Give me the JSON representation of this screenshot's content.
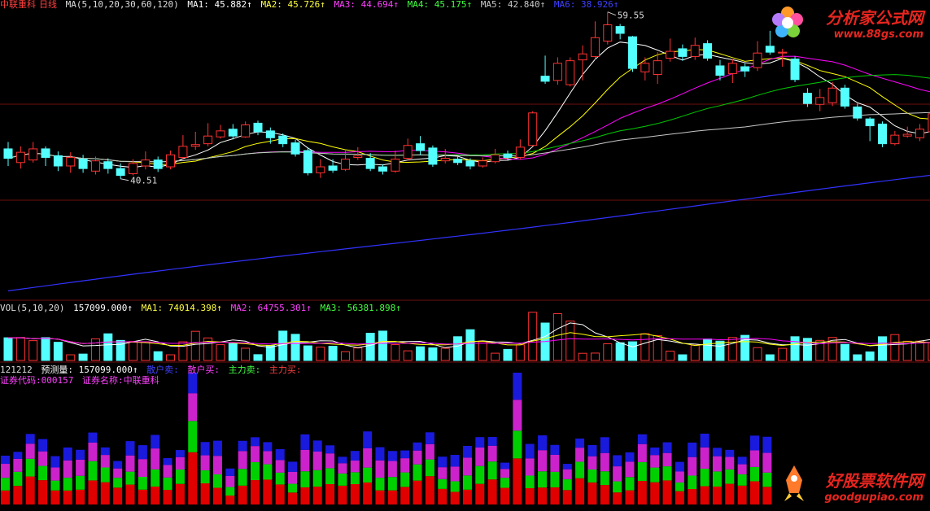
{
  "header_main": {
    "title": "中联重科",
    "period": "日线",
    "ma_label": "MA(5,10,20,30,60,120)",
    "ma1": "MA1: 45.882↑",
    "ma2": "MA2: 45.726↑",
    "ma3": "MA3: 44.694↑",
    "ma4": "MA4: 45.175↑",
    "ma5": "MA5: 42.840↑",
    "ma6": "MA6: 38.926↑"
  },
  "header_vol": {
    "label": "VOL(5,10,20)",
    "vol": "157099.000↑",
    "ma1": "MA1: 74014.398↑",
    "ma2": "MA2: 64755.301↑",
    "ma3": "MA3: 56381.898↑"
  },
  "header_ind": {
    "date": "121212",
    "forecast": "预测量: 157099.000↑",
    "retail_sell": "散户卖:",
    "retail_buy": "散户买:",
    "main_sell": "主力卖:",
    "main_buy": "主力买:"
  },
  "header_sec": {
    "code": "证券代码:000157",
    "name": "证券名称:中联重科"
  },
  "colors": {
    "up": "#ff3232",
    "down": "#54ffff",
    "ma5": "#ffffff",
    "ma10": "#ffff00",
    "ma20": "#ff00ff",
    "ma30": "#00cc00",
    "ma60": "#c8c8c8",
    "ma120": "#3232ff",
    "ind_red": "#e00000",
    "ind_green": "#00d000",
    "ind_magenta": "#cc22cc",
    "ind_blue": "#1a1add"
  },
  "watermarks": {
    "top_title": "分析家公式网",
    "top_url": "www.88gs.com",
    "bottom_title": "好股票软件网",
    "bottom_url": "goodgupiao.com"
  },
  "chart_data": {
    "type": "candlestick",
    "price_range": [
      26,
      61
    ],
    "annotations": {
      "high": "59.55",
      "low": "40.51"
    },
    "candles": [
      {
        "o": 43.6,
        "c": 42.5,
        "h": 44.4,
        "l": 41.6
      },
      {
        "o": 42.0,
        "c": 43.2,
        "h": 43.9,
        "l": 41.3
      },
      {
        "o": 42.3,
        "c": 43.6,
        "h": 44.4,
        "l": 42.0
      },
      {
        "o": 43.6,
        "c": 42.6,
        "h": 43.9,
        "l": 41.6
      },
      {
        "o": 42.8,
        "c": 41.6,
        "h": 43.3,
        "l": 41.0
      },
      {
        "o": 41.6,
        "c": 42.6,
        "h": 43.2,
        "l": 40.8
      },
      {
        "o": 42.4,
        "c": 41.3,
        "h": 42.9,
        "l": 40.8
      },
      {
        "o": 41.0,
        "c": 42.2,
        "h": 42.7,
        "l": 40.6
      },
      {
        "o": 42.1,
        "c": 41.3,
        "h": 42.5,
        "l": 40.7
      },
      {
        "o": 41.3,
        "c": 40.5,
        "h": 41.9,
        "l": 40.1
      },
      {
        "o": 40.7,
        "c": 41.9,
        "h": 42.4,
        "l": 40.5
      },
      {
        "o": 41.6,
        "c": 42.3,
        "h": 43.3,
        "l": 41.2
      },
      {
        "o": 42.3,
        "c": 41.3,
        "h": 42.7,
        "l": 40.9
      },
      {
        "o": 41.5,
        "c": 42.9,
        "h": 43.4,
        "l": 41.2
      },
      {
        "o": 42.6,
        "c": 43.9,
        "h": 45.2,
        "l": 42.4
      },
      {
        "o": 43.9,
        "c": 44.1,
        "h": 45.6,
        "l": 43.5
      },
      {
        "o": 44.2,
        "c": 45.1,
        "h": 46.6,
        "l": 43.9
      },
      {
        "o": 45.0,
        "c": 45.7,
        "h": 46.4,
        "l": 44.8
      },
      {
        "o": 45.9,
        "c": 45.1,
        "h": 46.5,
        "l": 44.7
      },
      {
        "o": 45.0,
        "c": 46.4,
        "h": 46.8,
        "l": 44.9
      },
      {
        "o": 46.6,
        "c": 45.6,
        "h": 46.9,
        "l": 45.2
      },
      {
        "o": 45.7,
        "c": 44.9,
        "h": 46.1,
        "l": 44.2
      },
      {
        "o": 45.1,
        "c": 44.2,
        "h": 45.4,
        "l": 43.8
      },
      {
        "o": 44.3,
        "c": 43.0,
        "h": 44.7,
        "l": 42.7
      },
      {
        "o": 43.4,
        "c": 40.8,
        "h": 43.8,
        "l": 40.5
      },
      {
        "o": 40.8,
        "c": 41.5,
        "h": 42.4,
        "l": 40.2
      },
      {
        "o": 41.6,
        "c": 41.1,
        "h": 42.4,
        "l": 40.8
      },
      {
        "o": 41.2,
        "c": 42.4,
        "h": 43.4,
        "l": 41.0
      },
      {
        "o": 42.6,
        "c": 42.8,
        "h": 43.8,
        "l": 42.3
      },
      {
        "o": 42.5,
        "c": 41.3,
        "h": 43.1,
        "l": 41.0
      },
      {
        "o": 41.5,
        "c": 41.0,
        "h": 41.8,
        "l": 40.6
      },
      {
        "o": 41.0,
        "c": 42.4,
        "h": 43.4,
        "l": 40.8
      },
      {
        "o": 42.5,
        "c": 44.0,
        "h": 44.8,
        "l": 42.2
      },
      {
        "o": 44.2,
        "c": 43.4,
        "h": 45.1,
        "l": 42.9
      },
      {
        "o": 43.7,
        "c": 41.8,
        "h": 44.0,
        "l": 41.5
      },
      {
        "o": 42.2,
        "c": 42.5,
        "h": 43.6,
        "l": 41.9
      },
      {
        "o": 42.4,
        "c": 42.0,
        "h": 42.8,
        "l": 41.7
      },
      {
        "o": 42.2,
        "c": 41.6,
        "h": 42.5,
        "l": 41.2
      },
      {
        "o": 41.6,
        "c": 42.2,
        "h": 42.6,
        "l": 41.4
      },
      {
        "o": 42.1,
        "c": 42.9,
        "h": 43.6,
        "l": 41.9
      },
      {
        "o": 43.0,
        "c": 42.6,
        "h": 43.4,
        "l": 42.3
      },
      {
        "o": 42.6,
        "c": 43.8,
        "h": 44.7,
        "l": 42.4
      },
      {
        "o": 44.0,
        "c": 47.8,
        "h": 48.0,
        "l": 44.0
      },
      {
        "o": 52.1,
        "c": 51.5,
        "h": 54.5,
        "l": 51.2
      },
      {
        "o": 51.6,
        "c": 53.6,
        "h": 54.3,
        "l": 51.1
      },
      {
        "o": 51.1,
        "c": 53.9,
        "h": 54.3,
        "l": 50.9
      },
      {
        "o": 54.0,
        "c": 54.7,
        "h": 55.7,
        "l": 51.6
      },
      {
        "o": 54.4,
        "c": 56.6,
        "h": 58.5,
        "l": 54.0
      },
      {
        "o": 56.2,
        "c": 58.1,
        "h": 59.6,
        "l": 55.8
      },
      {
        "o": 57.9,
        "c": 57.1,
        "h": 58.2,
        "l": 56.4
      },
      {
        "o": 56.7,
        "c": 53.0,
        "h": 56.8,
        "l": 52.6
      },
      {
        "o": 52.6,
        "c": 53.6,
        "h": 54.3,
        "l": 51.6
      },
      {
        "o": 52.3,
        "c": 53.9,
        "h": 54.9,
        "l": 51.2
      },
      {
        "o": 54.2,
        "c": 55.0,
        "h": 56.5,
        "l": 53.8
      },
      {
        "o": 55.3,
        "c": 54.4,
        "h": 55.8,
        "l": 53.9
      },
      {
        "o": 54.4,
        "c": 55.7,
        "h": 56.6,
        "l": 54.0
      },
      {
        "o": 55.9,
        "c": 54.2,
        "h": 56.3,
        "l": 53.9
      },
      {
        "o": 53.3,
        "c": 52.2,
        "h": 54.0,
        "l": 51.6
      },
      {
        "o": 52.4,
        "c": 53.6,
        "h": 54.1,
        "l": 51.3
      },
      {
        "o": 53.2,
        "c": 52.7,
        "h": 53.6,
        "l": 52.0
      },
      {
        "o": 53.1,
        "c": 54.8,
        "h": 56.2,
        "l": 52.7
      },
      {
        "o": 55.6,
        "c": 54.9,
        "h": 57.4,
        "l": 54.6
      },
      {
        "o": 54.8,
        "c": 54.9,
        "h": 55.3,
        "l": 53.2
      },
      {
        "o": 54.1,
        "c": 51.7,
        "h": 54.4,
        "l": 51.4
      },
      {
        "o": 50.1,
        "c": 48.9,
        "h": 50.7,
        "l": 48.5
      },
      {
        "o": 48.8,
        "c": 49.6,
        "h": 50.6,
        "l": 48.0
      },
      {
        "o": 49.0,
        "c": 50.7,
        "h": 51.4,
        "l": 48.6
      },
      {
        "o": 50.7,
        "c": 48.6,
        "h": 51.1,
        "l": 48.3
      },
      {
        "o": 48.5,
        "c": 47.2,
        "h": 48.9,
        "l": 46.9
      },
      {
        "o": 47.1,
        "c": 46.3,
        "h": 47.3,
        "l": 44.5
      },
      {
        "o": 46.5,
        "c": 44.2,
        "h": 46.8,
        "l": 43.8
      },
      {
        "o": 44.2,
        "c": 45.2,
        "h": 45.7,
        "l": 44.0
      },
      {
        "o": 45.1,
        "c": 45.3,
        "h": 46.2,
        "l": 44.9
      },
      {
        "o": 44.9,
        "c": 45.9,
        "h": 46.5,
        "l": 44.5
      },
      {
        "o": 45.6,
        "c": 47.7,
        "h": 48.0,
        "l": 45.3
      },
      {
        "o": 48.1,
        "c": 49.7,
        "h": 50.7,
        "l": 47.8
      },
      {
        "o": 48.9,
        "c": 47.5,
        "h": 49.3,
        "l": 47.1
      },
      {
        "o": 47.1,
        "c": 49.2,
        "h": 49.9,
        "l": 46.7
      },
      {
        "o": 48.7,
        "c": 49.5,
        "h": 49.7,
        "l": 47.2
      },
      {
        "o": 49.3,
        "c": 47.1,
        "h": 49.6,
        "l": 46.6
      }
    ],
    "volume_range": [
      0,
      175000
    ]
  }
}
